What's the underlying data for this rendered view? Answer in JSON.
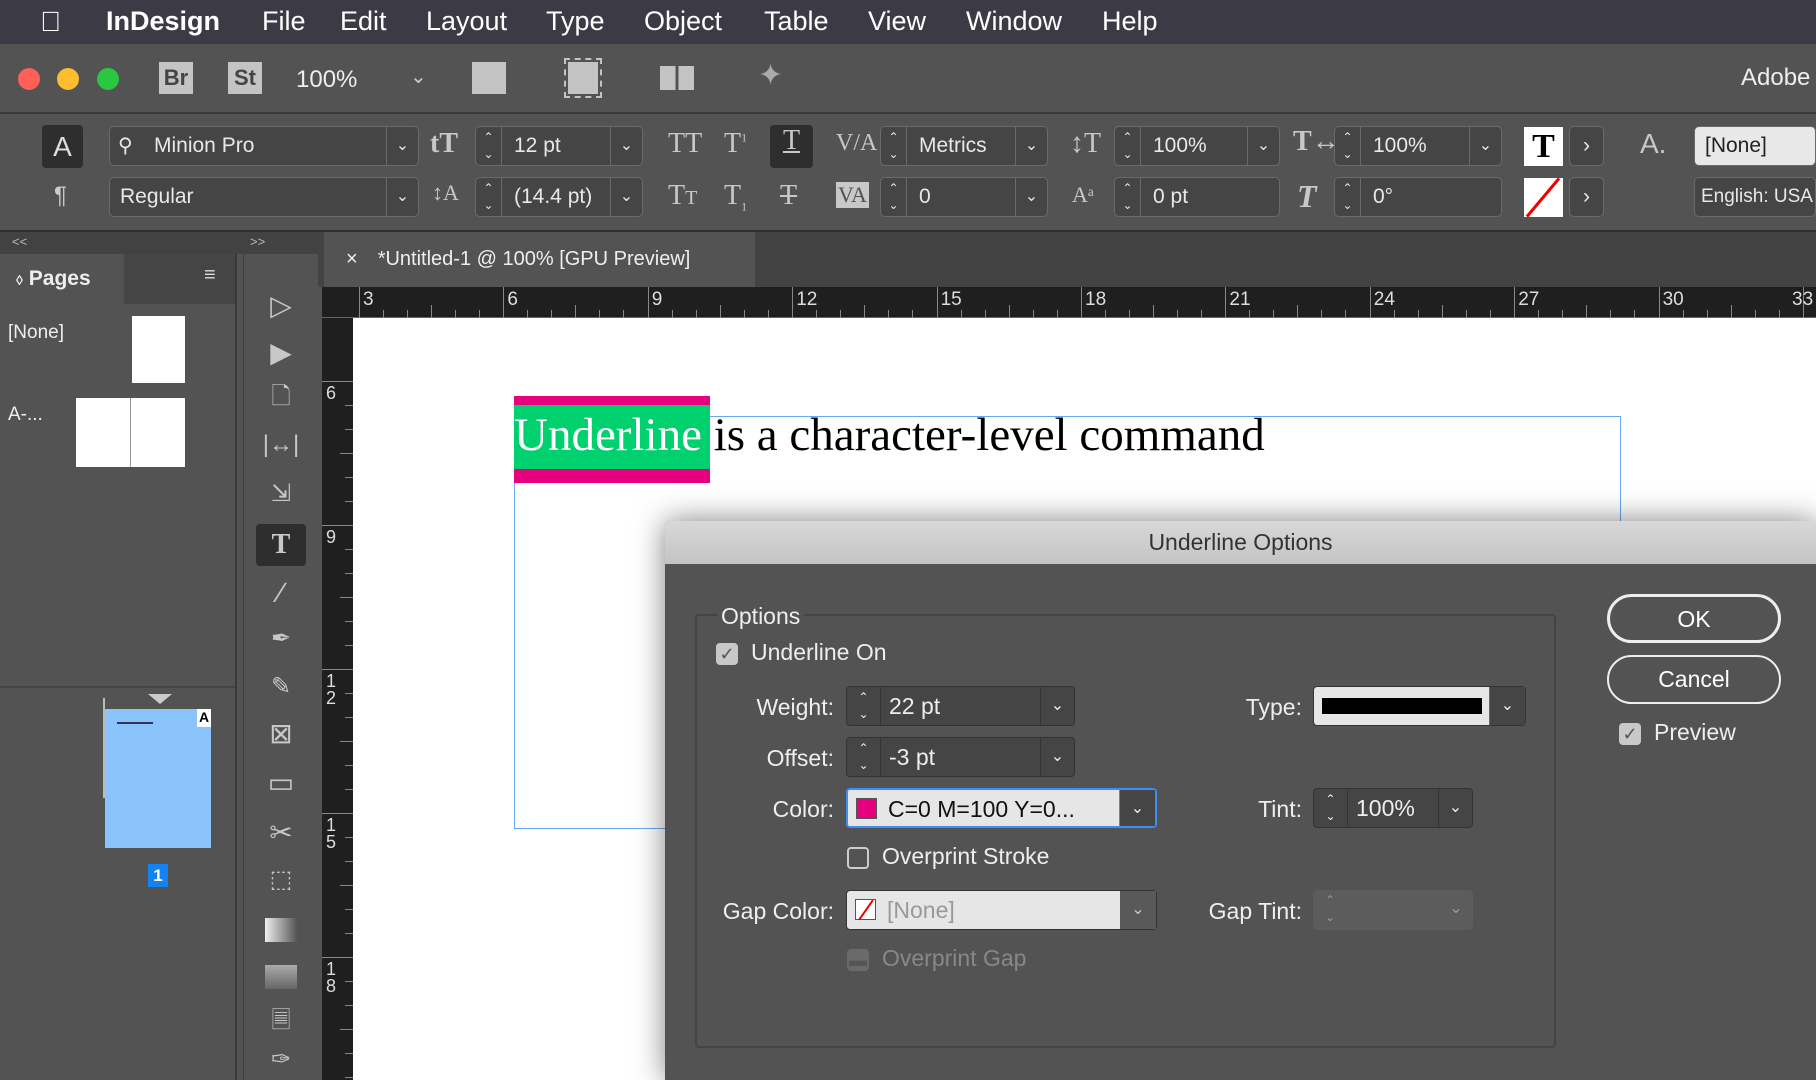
{
  "menubar": {
    "app": "InDesign",
    "items": [
      "File",
      "Edit",
      "Layout",
      "Type",
      "Object",
      "Table",
      "View",
      "Window",
      "Help"
    ]
  },
  "appbar": {
    "bridge": "Br",
    "stock": "St",
    "zoom": "100%",
    "adobe_label": "Adobe"
  },
  "control": {
    "font_family": "Minion Pro",
    "font_style": "Regular",
    "font_size": "12 pt",
    "leading": "(14.4 pt)",
    "kerning": "Metrics",
    "tracking": "0",
    "vertical_scale": "100%",
    "horizontal_scale": "100%",
    "baseline_shift": "0 pt",
    "skew": "0°",
    "char_style": "[None]",
    "language": "English: USA"
  },
  "panels": {
    "collapse": "<<",
    "expand": ">>"
  },
  "pages_panel": {
    "title": "Pages",
    "masters": [
      "[None]",
      "A-..."
    ],
    "page_number": "1",
    "master_letter": "A"
  },
  "document": {
    "tab_title": "*Untitled-1 @ 100% [GPU Preview]",
    "close": "×",
    "underlined_word": "Underline",
    "rest_text": " is a character-level command"
  },
  "rulers": {
    "horizontal": [
      "3",
      "6",
      "9",
      "12",
      "15",
      "18",
      "21",
      "24",
      "27",
      "30",
      "33"
    ],
    "vertical": [
      "6",
      "9",
      "1\n2",
      "1\n5",
      "1\n8"
    ]
  },
  "dialog": {
    "title": "Underline Options",
    "group": "Options",
    "underline_on": {
      "label": "Underline On",
      "checked": true
    },
    "weight": {
      "label": "Weight:",
      "value": "22 pt"
    },
    "offset": {
      "label": "Offset:",
      "value": "-3 pt"
    },
    "color": {
      "label": "Color:",
      "value": "C=0 M=100 Y=0...",
      "swatch": "#e6007e"
    },
    "type": {
      "label": "Type:"
    },
    "tint": {
      "label": "Tint:",
      "value": "100%"
    },
    "overprint_stroke": {
      "label": "Overprint Stroke",
      "checked": false
    },
    "gap_color": {
      "label": "Gap Color:",
      "value": "[None]"
    },
    "gap_tint": {
      "label": "Gap Tint:",
      "value": ""
    },
    "overprint_gap": {
      "label": "Overprint Gap",
      "checked": false,
      "disabled": true
    },
    "ok": "OK",
    "cancel": "Cancel",
    "preview": {
      "label": "Preview",
      "checked": true
    }
  },
  "colors": {
    "underline": "#e6007e",
    "highlight": "#00d06e",
    "accent": "#1a8cff"
  }
}
